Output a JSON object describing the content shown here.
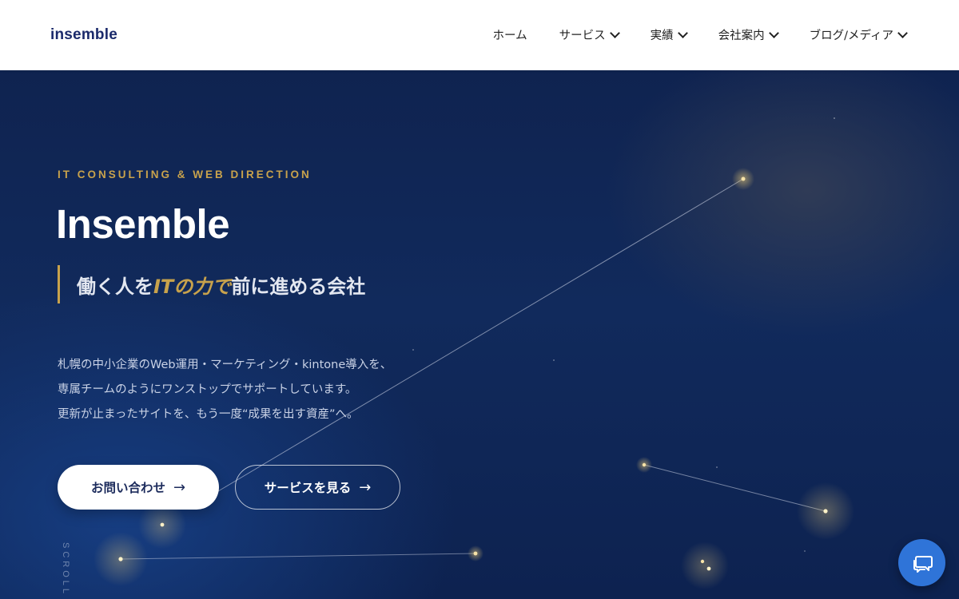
{
  "header": {
    "logo": "insemble",
    "nav": [
      {
        "label": "ホーム",
        "has_dropdown": false
      },
      {
        "label": "サービス",
        "has_dropdown": true
      },
      {
        "label": "実績",
        "has_dropdown": true
      },
      {
        "label": "会社案内",
        "has_dropdown": true
      },
      {
        "label": "ブログ/メディア",
        "has_dropdown": true
      }
    ]
  },
  "hero": {
    "eyebrow": "IT CONSULTING & WEB DIRECTION",
    "title": "Insemble",
    "tagline": {
      "before": "働く人を",
      "accent": "ITの力で",
      "after": "前に進める会社"
    },
    "description": [
      "札幌の中小企業のWeb運用・マーケティング・kintone導入を、",
      "専属チームのようにワンストップでサポートしています。",
      "更新が止まったサイトを、もう一度“成果を出す資産”へ。"
    ],
    "primary_button": {
      "label": "お問い合わせ",
      "arrow": "→"
    },
    "secondary_button": {
      "label": "サービスを見る",
      "arrow": "→"
    },
    "scroll_label": "SCROLL"
  },
  "chat_button": {
    "icon": "chat-bubbles-icon"
  },
  "colors": {
    "accent_gold": "#c8a24c",
    "navy": "#0f2350",
    "chat_blue": "#2f74d8",
    "logo_navy": "#1b2a6b"
  }
}
